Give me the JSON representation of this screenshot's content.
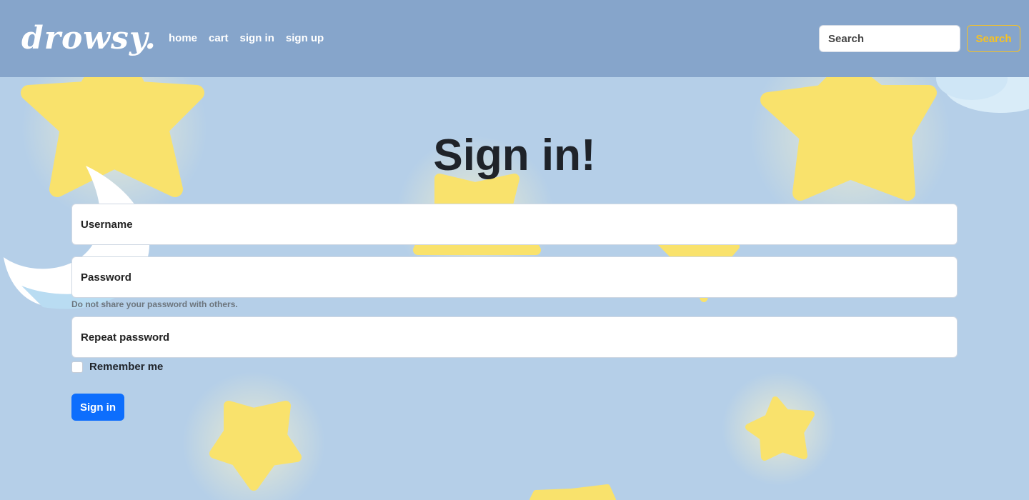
{
  "colors": {
    "navbar_bg": "#86a5cb",
    "page_bg": "#b5cfe8",
    "accent_yellow": "#f5c125",
    "primary_blue": "#0d6efd",
    "star_yellow": "#f9e26c"
  },
  "header": {
    "brand": "drowsy.",
    "nav": [
      {
        "label": "home"
      },
      {
        "label": "cart"
      },
      {
        "label": "sign in"
      },
      {
        "label": "sign up"
      }
    ],
    "search": {
      "placeholder": "Search",
      "button_label": "Search"
    }
  },
  "main": {
    "title": "Sign in!",
    "username_placeholder": "Username",
    "password_placeholder": "Password",
    "password_help": "Do not share your password with others.",
    "repeat_password_placeholder": "Repeat password",
    "remember_label": "Remember me",
    "remember_checked": false,
    "submit_label": "Sign in"
  },
  "background": {
    "icons": [
      "star-icon",
      "moon-icon",
      "cloud-icon"
    ]
  }
}
